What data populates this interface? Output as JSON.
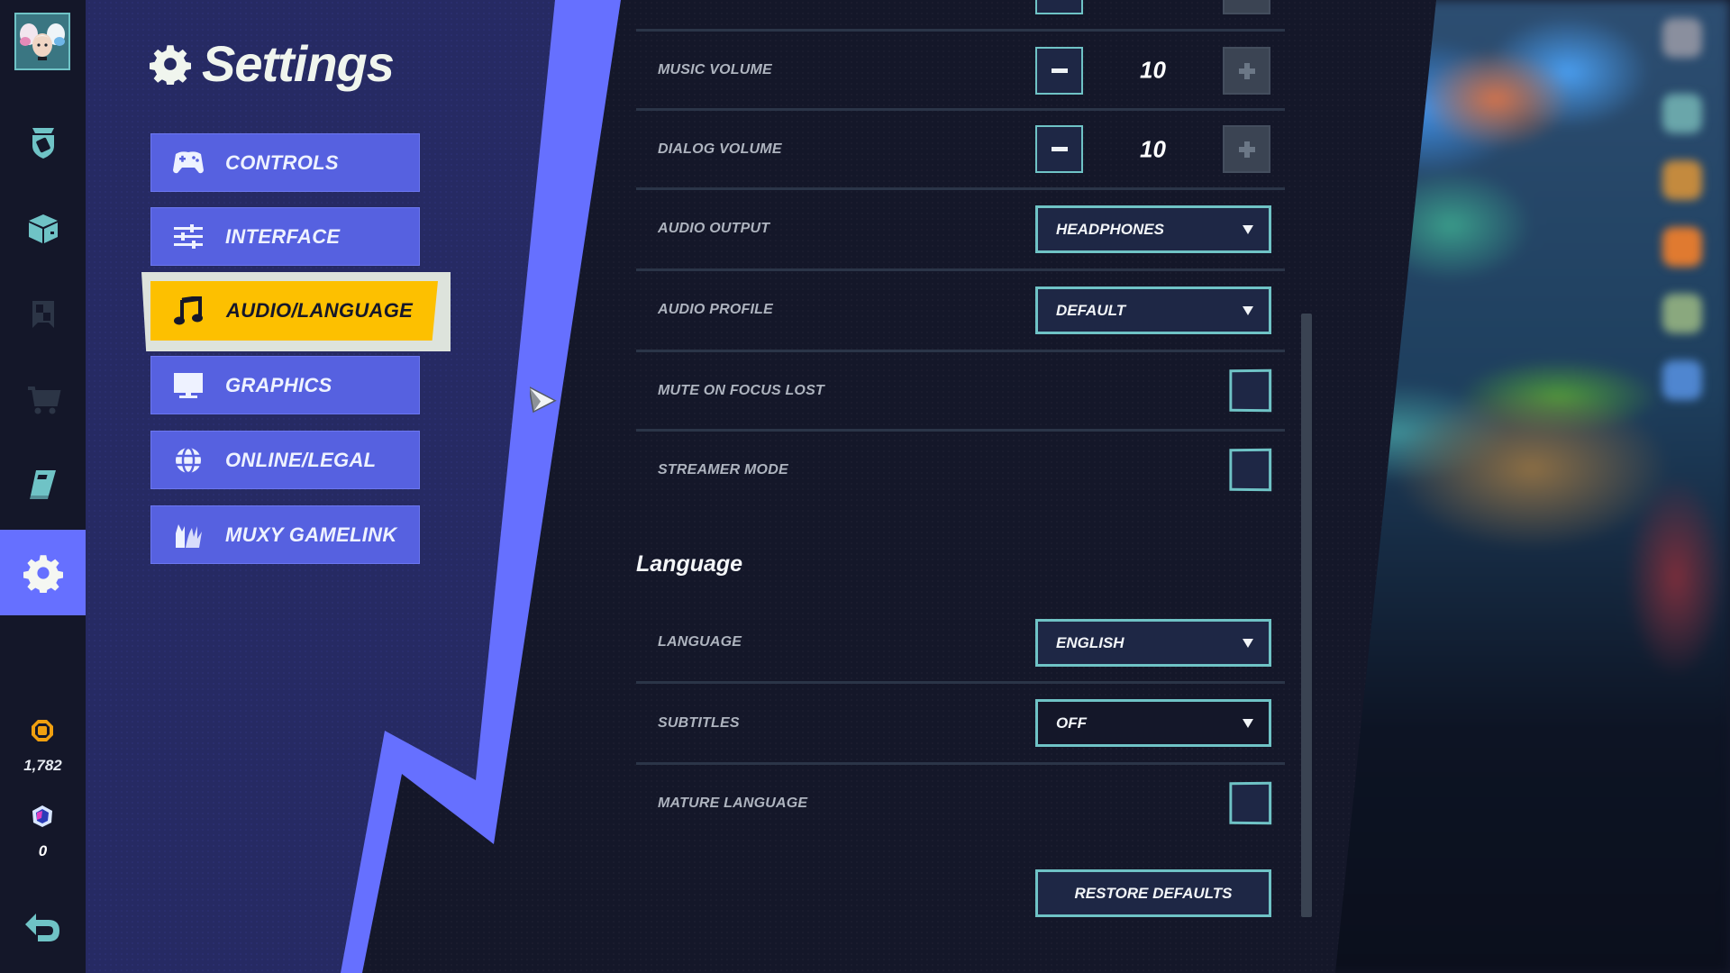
{
  "page": {
    "title": "Settings",
    "title_icon": "gear-icon"
  },
  "nav_rail": {
    "avatar": "player-avatar",
    "items": [
      {
        "name": "battle-pass",
        "icon": "shield-badge-icon",
        "active": false
      },
      {
        "name": "inventory",
        "icon": "box-icon",
        "active": false
      },
      {
        "name": "collection",
        "icon": "banner-icon",
        "active": false,
        "disabled": true
      },
      {
        "name": "store",
        "icon": "cart-icon",
        "active": false,
        "disabled": true
      },
      {
        "name": "journal",
        "icon": "book-icon",
        "active": false
      },
      {
        "name": "settings",
        "icon": "gear-icon",
        "active": true
      }
    ],
    "currency": {
      "gold": {
        "icon": "coin-icon",
        "amount": "1,782"
      },
      "gems": {
        "icon": "gem-icon",
        "amount": "0"
      }
    },
    "back_icon": "back-arrow-icon"
  },
  "categories": [
    {
      "label": "CONTROLS",
      "icon": "gamepad-icon",
      "active": false
    },
    {
      "label": "INTERFACE",
      "icon": "sliders-icon",
      "active": false
    },
    {
      "label": "AUDIO/LANGUAGE",
      "icon": "music-note-icon",
      "active": true
    },
    {
      "label": "GRAPHICS",
      "icon": "monitor-icon",
      "active": false
    },
    {
      "label": "ONLINE/LEGAL",
      "icon": "globe-icon",
      "active": false
    },
    {
      "label": "MUXY GAMELINK",
      "icon": "muxy-fox-icon",
      "active": false
    }
  ],
  "audio": {
    "music_volume": {
      "label": "MUSIC VOLUME",
      "value": "10",
      "minus": "−",
      "plus": "+",
      "plus_disabled": true
    },
    "dialog_volume": {
      "label": "DIALOG VOLUME",
      "value": "10",
      "minus": "−",
      "plus": "+",
      "plus_disabled": true
    },
    "audio_output": {
      "label": "AUDIO OUTPUT",
      "value": "HEADPHONES"
    },
    "audio_profile": {
      "label": "AUDIO PROFILE",
      "value": "DEFAULT"
    },
    "mute_on_focus_lost": {
      "label": "MUTE ON FOCUS LOST",
      "checked": false
    },
    "streamer_mode": {
      "label": "STREAMER MODE",
      "checked": false
    }
  },
  "language_section": {
    "heading": "Language",
    "language": {
      "label": "LANGUAGE",
      "value": "ENGLISH"
    },
    "subtitles": {
      "label": "SUBTITLES",
      "value": "OFF"
    },
    "mature_language": {
      "label": "MATURE LANGUAGE",
      "checked": false
    }
  },
  "restore_defaults_label": "RESTORE DEFAULTS",
  "colors": {
    "accent_teal": "#6fc3c6",
    "active_category": "#fdc000",
    "category_button": "#5661e0",
    "bolt": "#6670ff",
    "navy": "#262a63",
    "panel_bg": "#141729"
  }
}
